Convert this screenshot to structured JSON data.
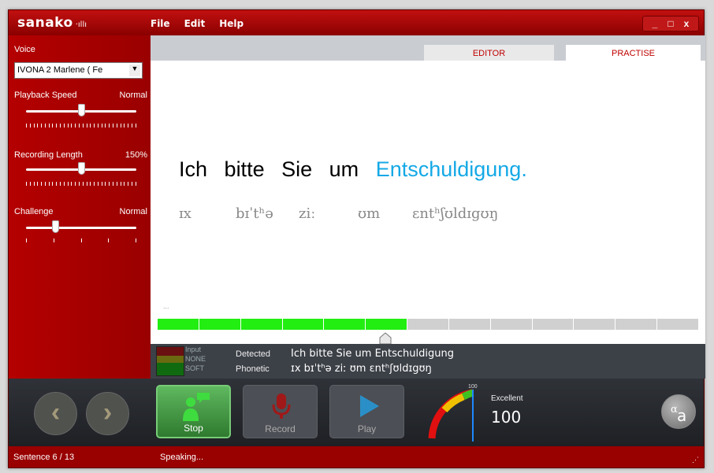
{
  "app": {
    "logo": "sanako",
    "logo_mark": "·ıllı"
  },
  "menu": [
    "File",
    "Edit",
    "Help"
  ],
  "window_buttons": {
    "minimize": "_",
    "maximize": "□",
    "close": "x"
  },
  "sidebar": {
    "voice_label": "Voice",
    "voice_value": "IVONA 2 Marlene ( Fe",
    "playback_label": "Playback Speed",
    "playback_value": "Normal",
    "playback_level": 0.5,
    "recording_label": "Recording Length",
    "recording_value": "150%",
    "recording_level": 0.5,
    "challenge_label": "Challenge",
    "challenge_value": "Normal",
    "challenge_level": 0.25
  },
  "tabs": {
    "editor": "EDITOR",
    "practise": "PRACTISE",
    "active": "PRACTISE"
  },
  "sentence": {
    "words": [
      "Ich",
      "bitte",
      "Sie",
      "um"
    ],
    "highlight": "Entschuldigung.",
    "phonetic": [
      "ɪx",
      "bɪˈtʰə",
      "ziː",
      "ʊm",
      "ɛntʰʃʊldɪgʊŋ"
    ],
    "meter_dots": "...",
    "meter_segments": 13,
    "meter_filled": 6,
    "highlight_color": "#14a9e6"
  },
  "info": {
    "input_label": "Input",
    "input_none": "NONE",
    "input_soft": "SOFT",
    "detected_label": "Detected",
    "detected_text": "Ich bitte Sie um Entschuldigung",
    "phonetic_label": "Phonetic",
    "phonetic_text": "ɪx bɪˈtʰə ziː ʊm ɛntʰʃʊldɪgʊŋ"
  },
  "controls": {
    "stop_label": "Stop",
    "record_label": "Record",
    "play_label": "Play",
    "gauge_max": "100",
    "gauge_value": 100,
    "rating": "Excellent",
    "score": "100"
  },
  "status": {
    "sentence": "Sentence 6 / 13",
    "state": "Speaking..."
  }
}
